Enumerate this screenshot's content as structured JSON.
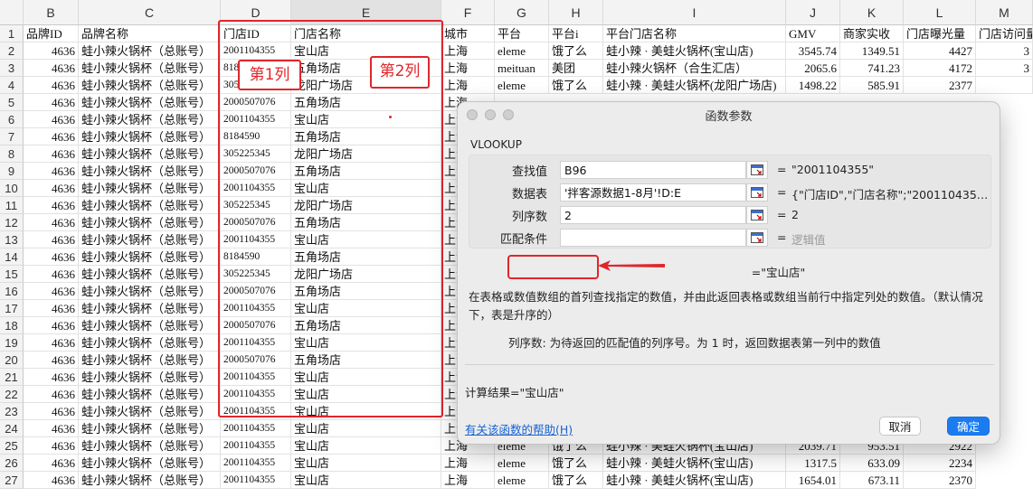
{
  "sheet": {
    "col_letters": [
      "B",
      "C",
      "D",
      "E",
      "F",
      "G",
      "H",
      "I",
      "J",
      "K",
      "L",
      "M"
    ],
    "row_numbers": [
      "1",
      "2",
      "3",
      "4",
      "5",
      "6",
      "7",
      "8",
      "9",
      "10",
      "11",
      "12",
      "13",
      "14",
      "15",
      "16",
      "17",
      "18",
      "19",
      "20",
      "21",
      "22",
      "23",
      "24",
      "25",
      "26",
      "27"
    ],
    "header_row": {
      "B": "品牌ID",
      "C": "品牌名称",
      "D": "门店ID",
      "E": "门店名称",
      "F": "城市",
      "G": "平台",
      "H": "平台i",
      "I": "平台门店名称",
      "J": "GMV",
      "K": "商家实收",
      "L": "门店曝光量",
      "M": "门店访问量"
    },
    "brand_id": "4636",
    "brand_name": "蛙小辣火锅杯（总账号）",
    "store_ids": [
      "2001104355",
      "8184590",
      "305225345",
      "2000507076",
      "2001104355",
      "8184590",
      "305225345",
      "2000507076",
      "2001104355",
      "305225345",
      "2000507076",
      "2001104355",
      "8184590",
      "305225345",
      "2000507076",
      "2001104355",
      "2000507076",
      "2001104355",
      "2000507076",
      "2001104355",
      "2001104355",
      "2001104355",
      "2001104355",
      "2001104355",
      "2001104355",
      "2001104355"
    ],
    "store_names": [
      "宝山店",
      "五角场店",
      "龙阳广场店",
      "五角场店",
      "宝山店",
      "五角场店",
      "龙阳广场店",
      "五角场店",
      "宝山店",
      "龙阳广场店",
      "五角场店",
      "宝山店",
      "五角场店",
      "龙阳广场店",
      "五角场店",
      "宝山店",
      "五角场店",
      "宝山店",
      "五角场店",
      "宝山店",
      "宝山店",
      "宝山店",
      "宝山店",
      "宝山店",
      "宝山店",
      "宝山店"
    ],
    "city_visible": [
      "上海",
      "上海",
      "上海",
      "上海",
      "上海",
      "上海",
      "上海",
      "上海",
      "上海",
      "上海",
      "上海",
      "上海",
      "上海",
      "上海",
      "上海",
      "上海",
      "上海",
      "上海",
      "上海",
      "上海",
      "上海",
      "上海",
      "上海",
      "上海",
      "上海",
      "上海"
    ],
    "platform_rows": [
      {
        "G": "eleme",
        "H": "饿了么",
        "I": "蛙小辣 · 美蛙火锅杯(宝山店)",
        "J": "3545.74",
        "K": "1349.51",
        "L": "4427",
        "M": "3"
      },
      {
        "G": "meituan",
        "H": "美团",
        "I": "蛙小辣火锅杯（合生汇店）",
        "J": "2065.6",
        "K": "741.23",
        "L": "4172",
        "M": "3"
      },
      {
        "G": "eleme",
        "H": "饿了么",
        "I": "蛙小辣 · 美蛙火锅杯(龙阳广场店)",
        "J": "1498.22",
        "K": "585.91",
        "L": "2377",
        "M": ""
      }
    ],
    "bottom_rows": [
      {
        "row": "25",
        "G": "eleme",
        "H": "饿了么",
        "I": "蛙小辣 · 美蛙火锅杯(宝山店)",
        "J": "2039.71",
        "K": "953.51",
        "L": "2922"
      },
      {
        "row": "26",
        "G": "eleme",
        "H": "饿了么",
        "I": "蛙小辣 · 美蛙火锅杯(宝山店)",
        "J": "1317.5",
        "K": "633.09",
        "L": "2234"
      },
      {
        "row": "27",
        "G": "eleme",
        "H": "饿了么",
        "I": "蛙小辣 · 美蛙火锅杯(宝山店)",
        "J": "1654.01",
        "K": "673.11",
        "L": "2370"
      }
    ],
    "annotations": {
      "col1": "第1列",
      "col2": "第2列"
    }
  },
  "dialog": {
    "title": "函数参数",
    "function_name": "VLOOKUP",
    "args": [
      {
        "label": "查找值",
        "value": "B96",
        "result": "\"2001104355\""
      },
      {
        "label": "数据表",
        "value": "'拌客源数据1-8月'!D:E",
        "result": "{\"门店ID\",\"门店名称\";\"2001104355\"…"
      },
      {
        "label": "列序数",
        "value": "2",
        "result": "2"
      },
      {
        "label": "匹配条件",
        "value": "",
        "result": "逻辑值"
      }
    ],
    "eq_sign": "=",
    "formula_result": "=\"宝山店\"",
    "description": "在表格或数值数组的首列查找指定的数值，并由此返回表格或数组当前行中指定列处的数值。（默认情况下，表是升序的）",
    "arg_description": "列序数: 为待返回的匹配值的列序号。为 1 时，返回数据表第一列中的数值",
    "calc_result": "计算结果=\"宝山店\"",
    "help_link": "有关该函数的帮助(H)",
    "cancel_label": "取消",
    "ok_label": "确定"
  },
  "colors": {
    "accent": "#1a7cf0",
    "annotation_red": "#e0262b"
  }
}
